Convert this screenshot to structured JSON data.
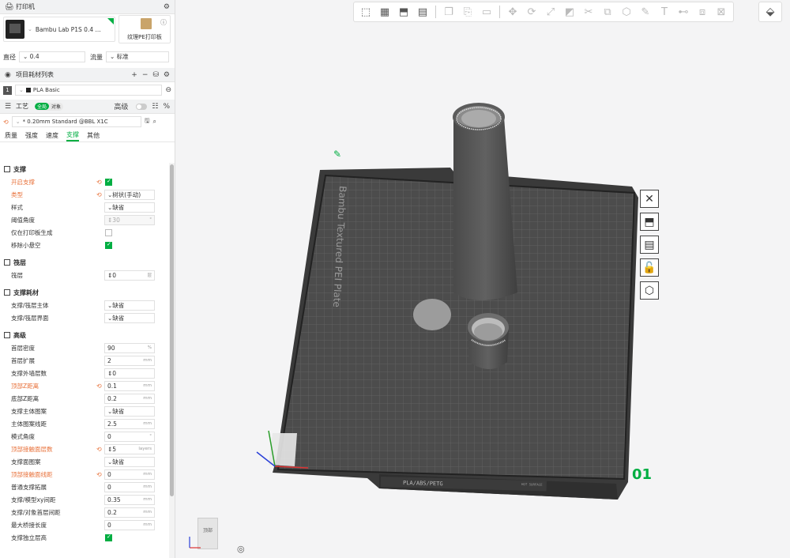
{
  "printer_section": {
    "title": "打印机",
    "printer_name": "Bambu Lab P1S 0.4 ...",
    "plate_name": "纹理PE打印板"
  },
  "nozzle": {
    "diameter_label": "直径",
    "diameter_value": "0.4",
    "flow_label": "流量",
    "flow_value": "标准"
  },
  "filament_section": {
    "title": "项目耗材列表",
    "items": [
      {
        "index": "1",
        "name": "PLA Basic",
        "color": "#222222"
      }
    ]
  },
  "process_section": {
    "title": "工艺",
    "global_label": "全局",
    "object_label": "对象",
    "advanced_label": "高级",
    "preset": "* 0.20mm Standard @BBL X1C",
    "tabs": [
      "质量",
      "强度",
      "速度",
      "支撑",
      "其他"
    ],
    "active_tab": "支撑"
  },
  "support": {
    "group_support": "支撑",
    "enable_support": "开启支撑",
    "type_label": "类型",
    "type_value": "树状(手动)",
    "style_label": "样式",
    "style_value": "缺省",
    "threshold_label": "阈值角度",
    "threshold_value": "30",
    "on_plate_only": "仅在打印板生成",
    "remove_small_overhang": "移除小悬空",
    "group_raft": "筏层",
    "raft_label": "筏层",
    "raft_value": "0",
    "group_filament": "支撑耗材",
    "support_base_label": "支撑/筏层主体",
    "support_base_value": "缺省",
    "support_interface_label": "支撑/筏层界面",
    "support_interface_value": "缺省",
    "group_advanced": "高级",
    "rows": [
      {
        "label": "首层密度",
        "value": "90",
        "unit": "%"
      },
      {
        "label": "首层扩展",
        "value": "2",
        "unit": "mm"
      },
      {
        "label": "支撑外墙层数",
        "value": "0",
        "unit": ""
      },
      {
        "label": "顶部Z距离",
        "value": "0.1",
        "unit": "mm"
      },
      {
        "label": "底部Z距离",
        "value": "0.2",
        "unit": "mm"
      },
      {
        "label": "支撑主体图案",
        "value": "缺省",
        "unit": ""
      },
      {
        "label": "主体图案线距",
        "value": "2.5",
        "unit": "mm"
      },
      {
        "label": "模式角度",
        "value": "0",
        "unit": "°"
      },
      {
        "label": "顶部接触面层数",
        "value": "5",
        "unit": "layers"
      },
      {
        "label": "支撑面图案",
        "value": "缺省",
        "unit": ""
      },
      {
        "label": "顶部接触面线距",
        "value": "0",
        "unit": "mm"
      },
      {
        "label": "普通支撑拓展",
        "value": "0",
        "unit": "mm"
      },
      {
        "label": "支撑/模型xy间距",
        "value": "0.35",
        "unit": "mm"
      },
      {
        "label": "支撑/对象首层间距",
        "value": "0.2",
        "unit": "mm"
      },
      {
        "label": "最大桥接长度",
        "value": "0",
        "unit": "mm"
      }
    ],
    "independent_layer_height": "支撑独立层高"
  },
  "viewport": {
    "plate_text": "Bambu Textured PEI Plate",
    "plate_label": "PLA/ABS/PETG",
    "plate_label_small": "HOT SURFACE",
    "plate_number": "01",
    "navcube_face": "顶部"
  }
}
